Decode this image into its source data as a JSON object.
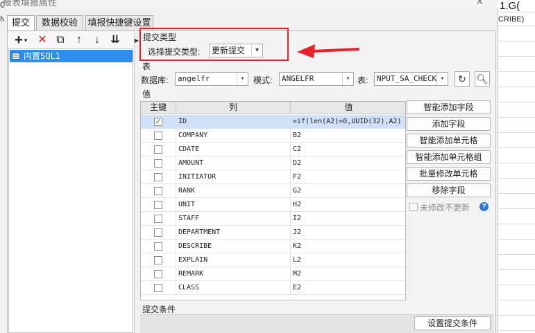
{
  "window": {
    "title": "报表填报属性",
    "close_glyph": "×"
  },
  "background": {
    "cell_1": "1.G(",
    "cell_2": "CRIBE)",
    "left_fragment_1": "G",
    "left_fragment_2": "N"
  },
  "tabs": [
    {
      "label": "提交",
      "active": true
    },
    {
      "label": "数据校验",
      "active": false
    },
    {
      "label": "填报快捷键设置",
      "active": false
    }
  ],
  "left_toolbar": {
    "add_glyph": "+",
    "dropdown_glyph": "▾",
    "delete_glyph": "✕",
    "copy_glyph": "⧉",
    "up_glyph": "↑",
    "down_glyph": "↓",
    "sort_glyph": "⇊"
  },
  "submission_list": [
    {
      "label": "内置SQL1",
      "selected": true
    }
  ],
  "submit_type": {
    "section_label": "提交类型",
    "field_label": "选择提交类型:",
    "value": "更新提交"
  },
  "table_section": {
    "section_label": "表",
    "db_label": "数据库:",
    "db_value": "angelfr",
    "schema_label": "模式:",
    "schema_value": "ANGELFR",
    "table_label": "表:",
    "table_value": "NPUT_SA_CHECK"
  },
  "value_section": {
    "section_label": "值",
    "columns": {
      "key": "主键",
      "column": "列",
      "value": "值"
    },
    "rows": [
      {
        "key": true,
        "column": "ID",
        "value": "=if(len(A2)=0,UUID(32),A2)",
        "selected": true
      },
      {
        "key": false,
        "column": "COMPANY",
        "value": "B2"
      },
      {
        "key": false,
        "column": "CDATE",
        "value": "C2"
      },
      {
        "key": false,
        "column": "AMOUNT",
        "value": "D2"
      },
      {
        "key": false,
        "column": "INITIATOR",
        "value": "F2"
      },
      {
        "key": false,
        "column": "RANK",
        "value": "G2"
      },
      {
        "key": false,
        "column": "UNIT",
        "value": "H2"
      },
      {
        "key": false,
        "column": "STAFF",
        "value": "I2"
      },
      {
        "key": false,
        "column": "DEPARTMENT",
        "value": "J2"
      },
      {
        "key": false,
        "column": "DESCRIBE",
        "value": "K2"
      },
      {
        "key": false,
        "column": "EXPLAIN",
        "value": "L2"
      },
      {
        "key": false,
        "column": "REMARK",
        "value": "M2"
      },
      {
        "key": false,
        "column": "CLASS",
        "value": "E2"
      }
    ],
    "check_glyph": "✓"
  },
  "side_buttons": {
    "smart_add_field": "智能添加字段",
    "add_field": "添加字段",
    "smart_add_cell": "智能添加单元格",
    "smart_add_cell_group": "智能添加单元格组",
    "batch_modify_cell": "批量修改单元格",
    "remove_field": "移除字段",
    "unmodified_no_update": "未修改不更新",
    "help_glyph": "?"
  },
  "condition": {
    "section_label": "提交条件",
    "button_label": "设置提交条件"
  },
  "colors": {
    "selection_blue": "#2d8ef0",
    "annotation_red": "#e8222a",
    "row_highlight": "#cfe0f7"
  }
}
